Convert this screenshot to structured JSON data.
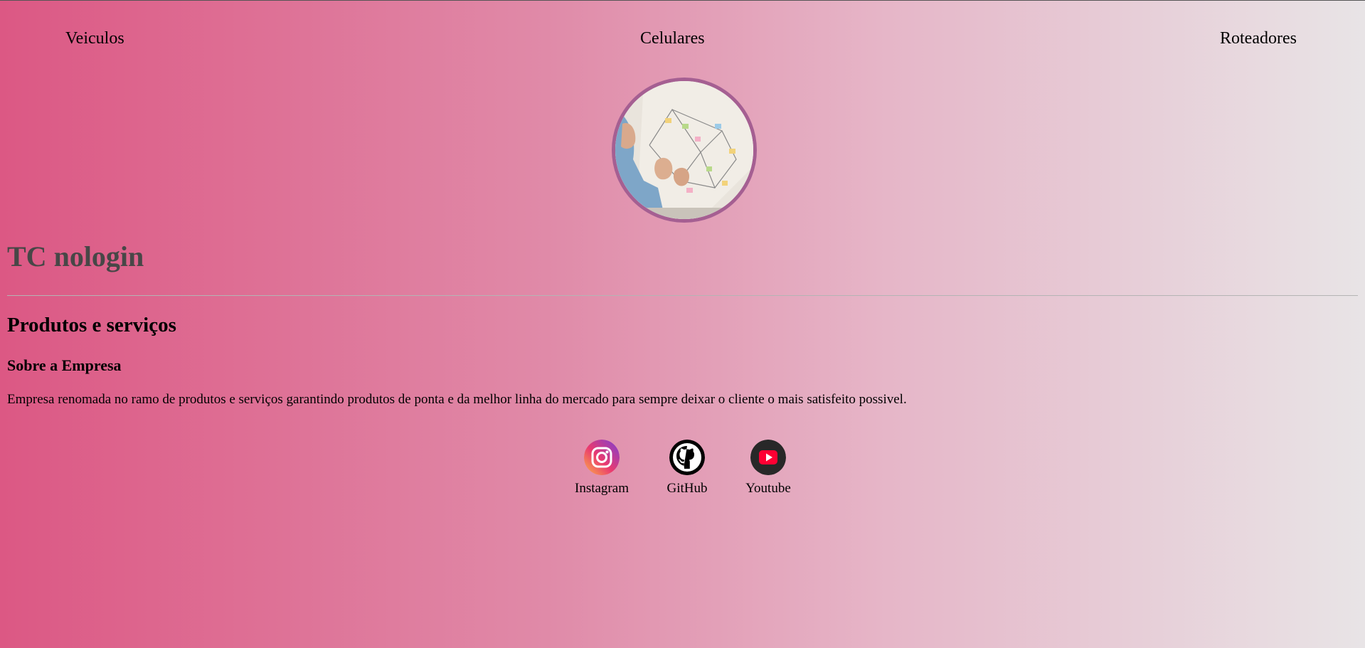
{
  "nav": {
    "items": [
      {
        "label": "Veiculos"
      },
      {
        "label": "Celulares"
      },
      {
        "label": "Roteadores"
      }
    ]
  },
  "hero": {
    "image": "team-planning-photo"
  },
  "brand": {
    "title": "TC nologin"
  },
  "content": {
    "heading": "Produtos e serviços",
    "subheading": "Sobre a Empresa",
    "description": "Empresa renomada no ramo de produtos e serviços garantindo produtos de ponta e da melhor linha do mercado para sempre deixar o cliente o mais satisfeito possivel."
  },
  "social": [
    {
      "label": "Instagram",
      "icon": "instagram-icon"
    },
    {
      "label": "GitHub",
      "icon": "github-icon"
    },
    {
      "label": "Youtube",
      "icon": "youtube-icon"
    }
  ],
  "colors": {
    "gradient_start": "#dc5884",
    "gradient_end": "#e8e4e6",
    "avatar_border": "#a55f92",
    "brand_text": "#474747"
  }
}
